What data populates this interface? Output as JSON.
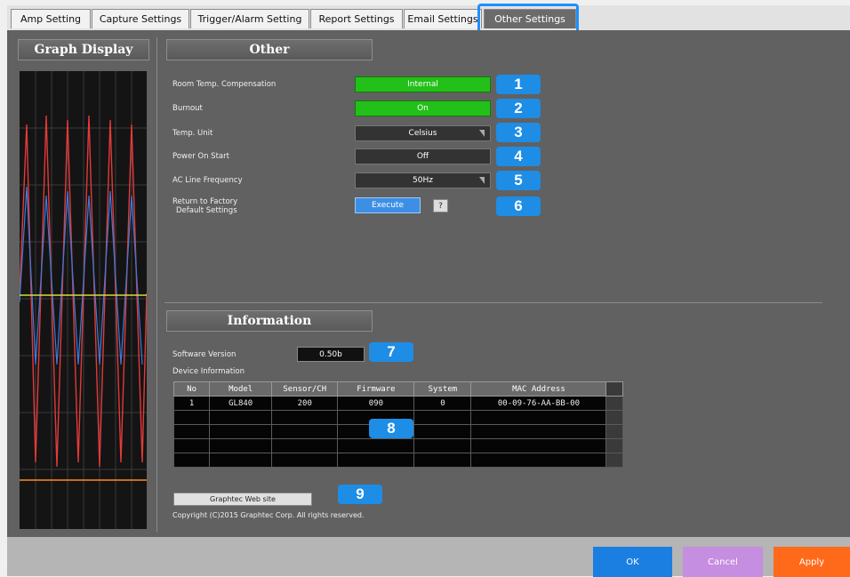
{
  "tabs": [
    "Amp Setting",
    "Capture Settings",
    "Trigger/Alarm Setting",
    "Report Settings",
    "Email Settings",
    "Other Settings"
  ],
  "graph_panel_title": "Graph Display",
  "other": {
    "title": "Other",
    "room_temp_label": "Room Temp. Compensation",
    "room_temp_value": "Internal",
    "burnout_label": "Burnout",
    "burnout_value": "On",
    "temp_unit_label": "Temp. Unit",
    "temp_unit_value": "Celsius",
    "power_on_start_label": "Power On Start",
    "power_on_start_value": "Off",
    "ac_line_label": "AC Line Frequency",
    "ac_line_value": "50Hz",
    "factory_label_1": "Return to Factory",
    "factory_label_2": "Default Settings",
    "execute_label": "Execute",
    "help_label": "?"
  },
  "info": {
    "title": "Information",
    "software_version_label": "Software Version",
    "software_version_value": "0.50b",
    "device_info_label": "Device Information",
    "columns": [
      "No",
      "Model",
      "Sensor/CH",
      "Firmware",
      "System",
      "MAC Address"
    ],
    "row": {
      "no": "1",
      "model": "GL840",
      "sensor": "200",
      "firmware": "090",
      "system": "0",
      "mac": "00-09-76-AA-BB-00"
    },
    "web_button": "Graphtec Web site",
    "copyright": "Copyright (C)2015 Graphtec Corp. All rights reserved."
  },
  "badges": [
    "1",
    "2",
    "3",
    "4",
    "5",
    "6",
    "7",
    "8",
    "9"
  ],
  "footer": {
    "ok": "OK",
    "cancel": "Cancel",
    "apply": "Apply"
  },
  "colors": {
    "highlight": "#1e90ff",
    "green": "#23c019",
    "ok": "#1a7fe0",
    "cancel": "#c58ee0",
    "apply": "#ff6a1a"
  }
}
